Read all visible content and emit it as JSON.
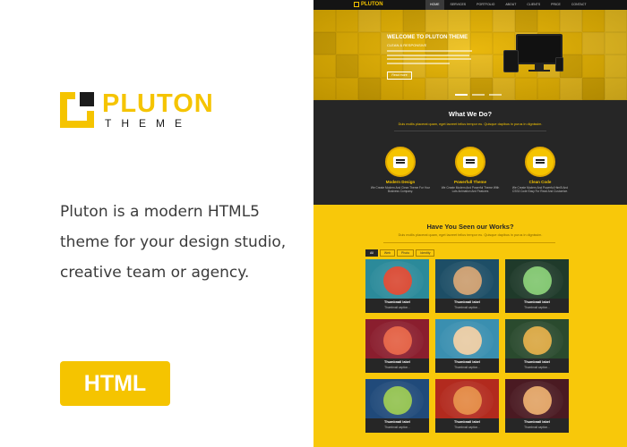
{
  "promo": {
    "logo_word": "PLUTON",
    "logo_sub": "THEME",
    "lines": [
      "Pluton is a modern HTML5",
      "theme for your design studio,",
      "creative team or agency."
    ],
    "badge": "HTML",
    "accent": "#f5c400"
  },
  "site": {
    "logo": "PLUTON",
    "nav": [
      "HOME",
      "SERVICES",
      "PORTFOLIO",
      "ABOUT",
      "CLIENTS",
      "PRICE",
      "CONTACT"
    ],
    "hero": {
      "title": "WELCOME TO PLUTON THEME",
      "subtitle": "CLEAN & RESPONSIVE",
      "button": "Read more"
    },
    "what_we_do": {
      "title": "What We Do?",
      "subtitle": "Duis mollis placerat quam, eget laoreet tellus tempor eu. Quisque dapibus in purus in dignissim.",
      "services": [
        {
          "icon": "store-icon",
          "title": "Modern Design",
          "text": "We Create Modern And Clean Theme For Your Business Company."
        },
        {
          "icon": "calculator-icon",
          "title": "Powerfull Theme",
          "text": "We Create Modern And Powerful Theme With Lots Animation And Features"
        },
        {
          "icon": "printer-icon",
          "title": "Clean Code",
          "text": "We Create Modern And Powerful Html5 And CSS3 Code Easy For Read And Customize."
        }
      ]
    },
    "works": {
      "title": "Have You Seen our Works?",
      "subtitle": "Duis mollis placerat quam, eget laoreet tellus tempor eu. Quisque dapibus in purus in dignissim.",
      "filters": [
        "All",
        "Web",
        "Photo",
        "Identity"
      ],
      "items": [
        {
          "label": "Thumbnail label",
          "caption": "Thumbnail caption...",
          "bg": "#2b8a9a",
          "fg": "#d8432c"
        },
        {
          "label": "Thumbnail label",
          "caption": "Thumbnail caption...",
          "bg": "#1d4e66",
          "fg": "#c99a6a"
        },
        {
          "label": "Thumbnail label",
          "caption": "Thumbnail caption...",
          "bg": "#1f3a2a",
          "fg": "#7cc46a"
        },
        {
          "label": "Thumbnail label",
          "caption": "Thumbnail caption...",
          "bg": "#8a1e2e",
          "fg": "#e25a3c"
        },
        {
          "label": "Thumbnail label",
          "caption": "Thumbnail caption...",
          "bg": "#3a8fb0",
          "fg": "#e7c9a0"
        },
        {
          "label": "Thumbnail label",
          "caption": "Thumbnail caption...",
          "bg": "#2a4a2e",
          "fg": "#d8a43c"
        },
        {
          "label": "Thumbnail label",
          "caption": "Thumbnail caption...",
          "bg": "#204a7a",
          "fg": "#8fc04a"
        },
        {
          "label": "Thumbnail label",
          "caption": "Thumbnail caption...",
          "bg": "#b22a1e",
          "fg": "#e2843c"
        },
        {
          "label": "Thumbnail label",
          "caption": "Thumbnail caption...",
          "bg": "#4a1a22",
          "fg": "#e0a060"
        }
      ]
    }
  }
}
